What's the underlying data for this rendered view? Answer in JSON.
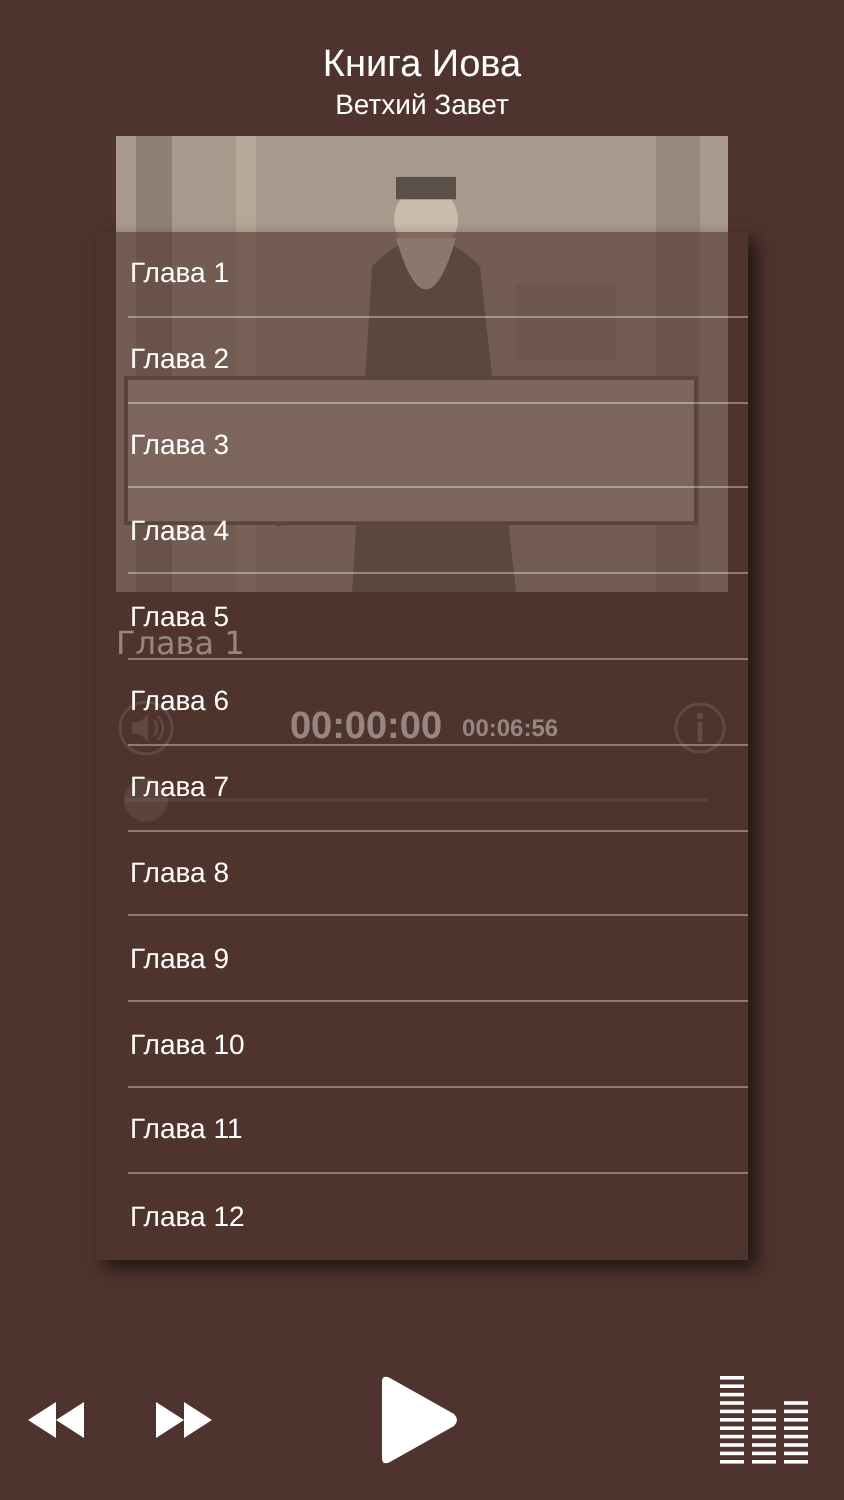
{
  "header": {
    "title": "Книга Иова",
    "subtitle": "Ветхий Завет"
  },
  "player": {
    "track": "Глава 1",
    "elapsed": "00:00:00",
    "duration": "00:06:56",
    "level": 0
  },
  "chapters": [
    {
      "label": "Глава 1"
    },
    {
      "label": "Глава 2"
    },
    {
      "label": "Глава 3"
    },
    {
      "label": "Глава 4"
    },
    {
      "label": "Глава 5"
    },
    {
      "label": "Глава 6"
    },
    {
      "label": "Глава 7"
    },
    {
      "label": "Глава 8"
    },
    {
      "label": "Глава 9"
    },
    {
      "label": "Глава 10"
    },
    {
      "label": "Глава 11"
    },
    {
      "label": "Глава 12"
    }
  ]
}
